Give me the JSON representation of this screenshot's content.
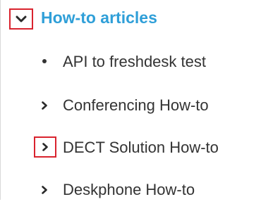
{
  "tree": {
    "parent": {
      "label": "How-to articles",
      "toggle_icon": "chevron-down-icon",
      "expanded": true
    },
    "children": [
      {
        "label": "API to freshdesk test",
        "marker_icon": "bullet-icon"
      },
      {
        "label": "Conferencing How-to",
        "marker_icon": "chevron-right-icon"
      },
      {
        "label": "DECT Solution How-to",
        "marker_icon": "chevron-right-icon"
      },
      {
        "label": "Deskphone How-to",
        "marker_icon": "chevron-right-icon"
      }
    ]
  },
  "colors": {
    "parent_link": "#2f9fd8",
    "item_text": "#333333",
    "highlight_box": "#d9232e"
  }
}
